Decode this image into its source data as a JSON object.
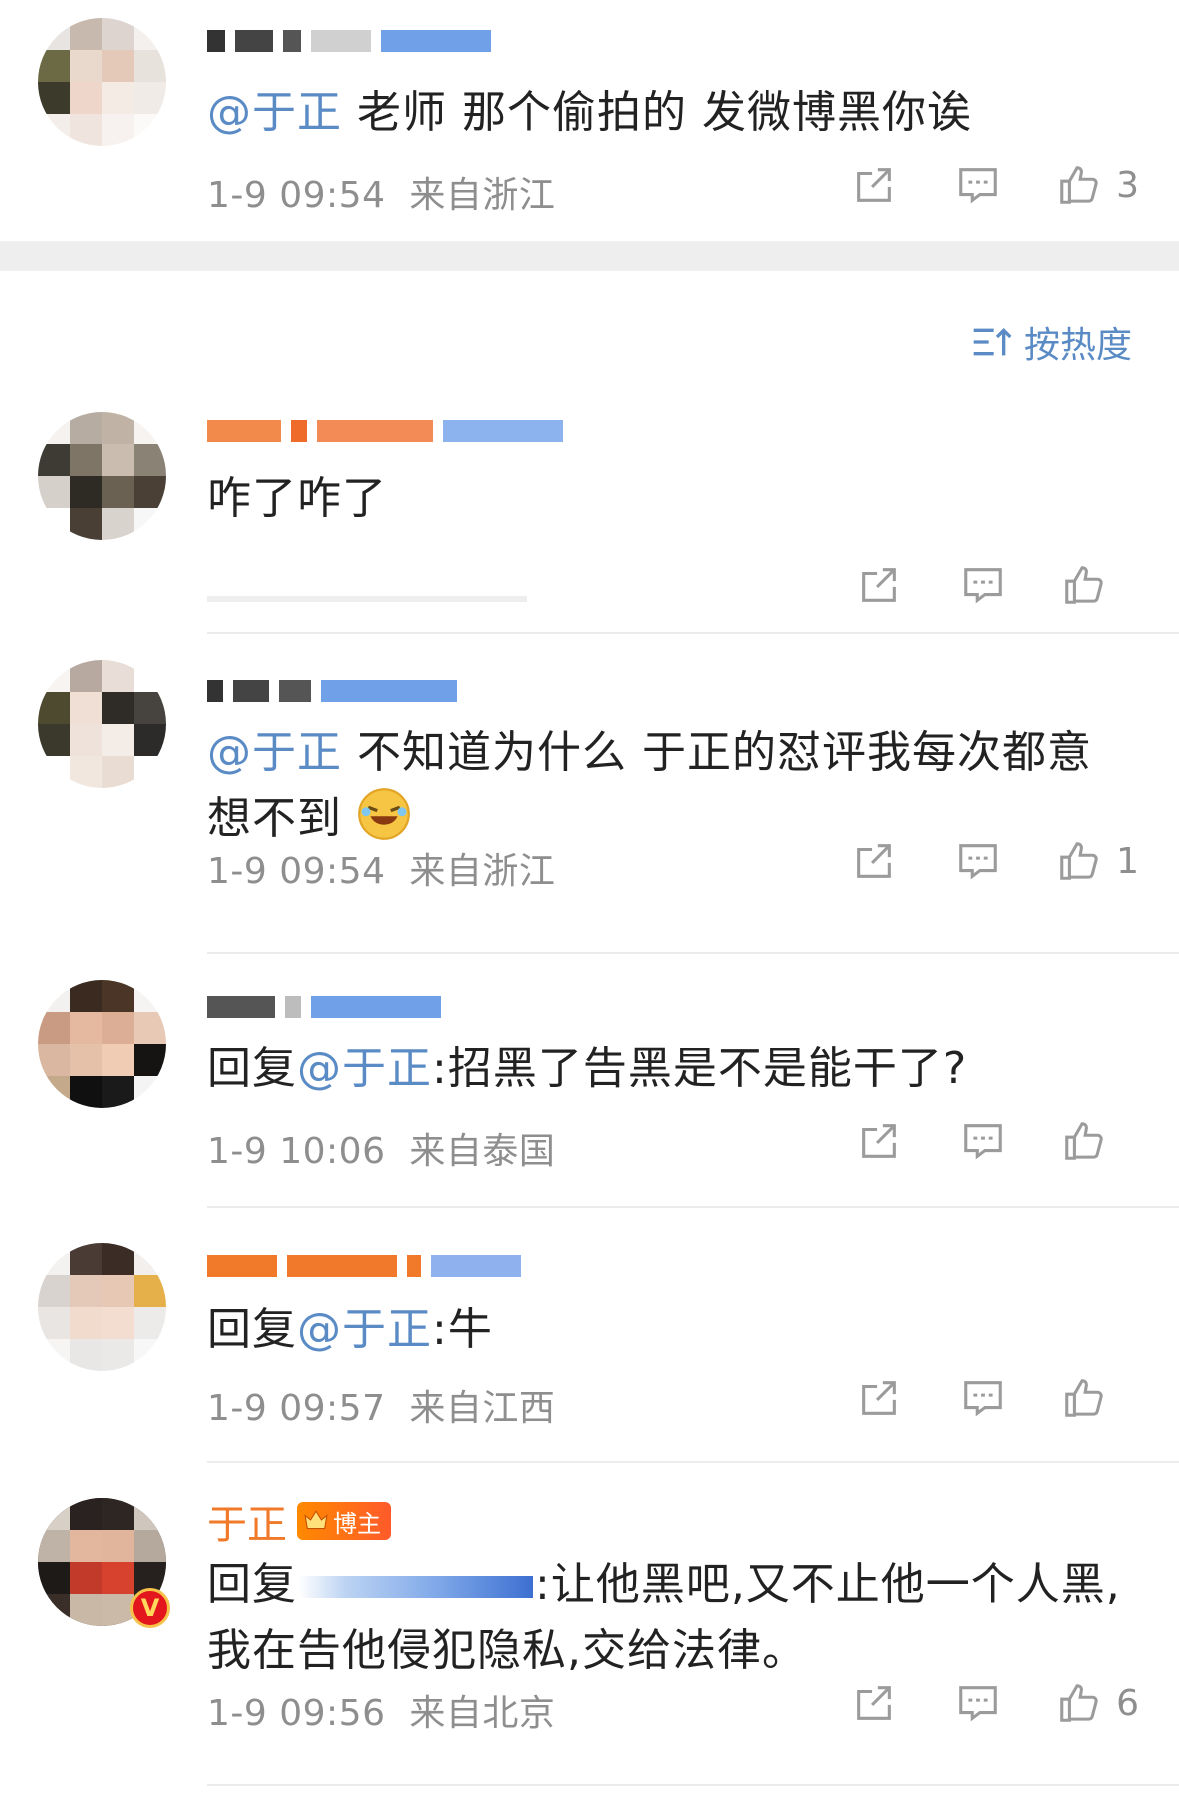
{
  "sort": {
    "label": "按热度",
    "icon": "sort-icon"
  },
  "comments": [
    {
      "mention": "@于正",
      "body": " 老师 那个偷拍的 发微博黑你诶",
      "time": "1-9 09:54",
      "location": "来自浙江",
      "likes": "3"
    },
    {
      "mention": "",
      "body": "咋了咋了",
      "time": "",
      "location": "",
      "likes": ""
    },
    {
      "mention": "@于正",
      "body": " 不知道为什么 于正的怼评我每次都意想不到",
      "time": "1-9 09:54",
      "location": "来自浙江",
      "likes": "1"
    },
    {
      "prefix": "回复",
      "mention": "@于正",
      "body": ":招黑了告黑是不是能干了?",
      "time": "1-9 10:06",
      "location": "来自泰国",
      "likes": ""
    },
    {
      "prefix": "回复",
      "mention": "@于正",
      "body": ":牛",
      "time": "1-9 09:57",
      "location": "来自江西",
      "likes": ""
    },
    {
      "author": "于正",
      "author_badge": "博主",
      "prefix": "回复",
      "body": ":让他黑吧,又不止他一个人黑,我在告他侵犯隐私,交给法律。",
      "time": "1-9 09:56",
      "location": "来自北京",
      "likes": "6"
    }
  ],
  "colors": {
    "link": "#5a8bc5",
    "meta": "#8e8e8e",
    "author": "#f07a2a"
  }
}
